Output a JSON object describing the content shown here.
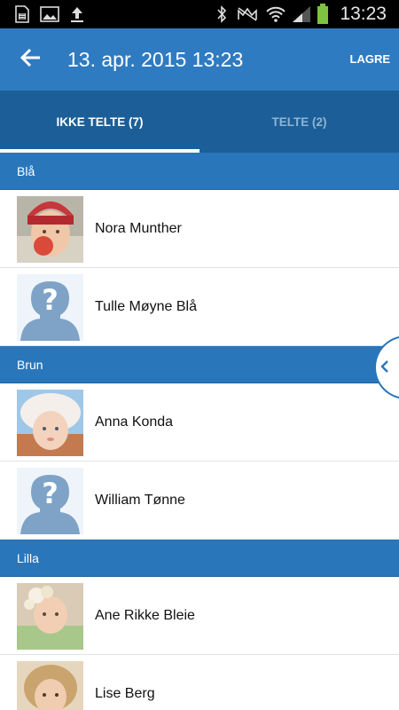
{
  "status_bar": {
    "time": "13:23",
    "icons": [
      "sim-card-icon",
      "image-icon",
      "upload-icon",
      "bluetooth-icon",
      "mute-icon",
      "wifi-icon",
      "signal-icon",
      "battery-icon"
    ]
  },
  "app_bar": {
    "title": "13. apr. 2015 13:23",
    "save_label": "LAGRE",
    "back_icon": "arrow-left-icon"
  },
  "tabs": [
    {
      "label": "IKKE TELTE (7)",
      "active": true
    },
    {
      "label": "TELTE (2)",
      "active": false
    }
  ],
  "groups": [
    {
      "name": "Blå",
      "items": [
        {
          "name": "Nora Munther",
          "avatar": "photo-child-red-hat"
        },
        {
          "name": "Tulle Møyne Blå",
          "avatar": "placeholder-question"
        }
      ]
    },
    {
      "name": "Brun",
      "items": [
        {
          "name": "Anna Konda",
          "avatar": "photo-baby-sunhat"
        },
        {
          "name": "William Tønne",
          "avatar": "placeholder-question"
        }
      ]
    },
    {
      "name": "Lilla",
      "items": [
        {
          "name": "Ane Rikke Bleie",
          "avatar": "photo-baby-flower"
        },
        {
          "name": "Lise Berg",
          "avatar": "photo-girl-curly"
        }
      ]
    }
  ],
  "colors": {
    "app_bar": "#2f7bc1",
    "tabs_bg": "#1c5f98",
    "group_header": "#2a76bb",
    "inactive_tab_text": "#8fb4d6"
  }
}
